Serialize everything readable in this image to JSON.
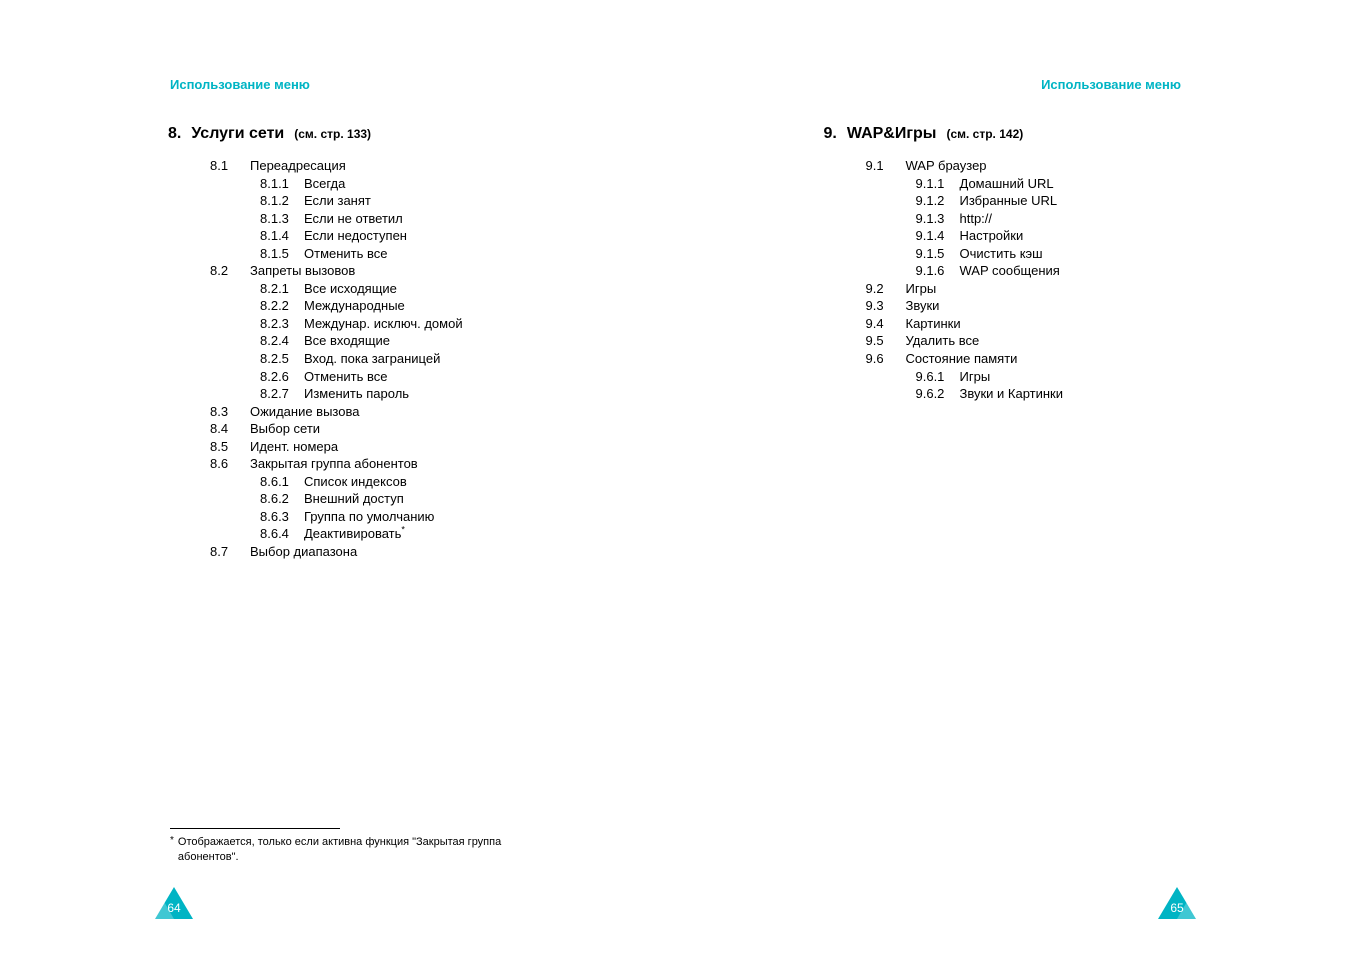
{
  "header": {
    "text": "Использование меню"
  },
  "pageNumbers": {
    "left": "64",
    "right": "65"
  },
  "left": {
    "section": {
      "num": "8.",
      "title": "Услуги сети",
      "ref": "(см. стр. 133)"
    },
    "items": [
      {
        "lvl": 2,
        "num": "8.1",
        "text": "Переадресация"
      },
      {
        "lvl": 3,
        "num": "8.1.1",
        "text": "Всегда"
      },
      {
        "lvl": 3,
        "num": "8.1.2",
        "text": "Если занят"
      },
      {
        "lvl": 3,
        "num": "8.1.3",
        "text": "Если не ответил"
      },
      {
        "lvl": 3,
        "num": "8.1.4",
        "text": "Если недоступен"
      },
      {
        "lvl": 3,
        "num": "8.1.5",
        "text": "Отменить все"
      },
      {
        "lvl": 2,
        "num": "8.2",
        "text": "Запреты вызовов"
      },
      {
        "lvl": 3,
        "num": "8.2.1",
        "text": "Все исходящие"
      },
      {
        "lvl": 3,
        "num": "8.2.2",
        "text": "Международные"
      },
      {
        "lvl": 3,
        "num": "8.2.3",
        "text": "Междунар. исключ. домой"
      },
      {
        "lvl": 3,
        "num": "8.2.4",
        "text": "Все входящие"
      },
      {
        "lvl": 3,
        "num": "8.2.5",
        "text": "Вход. пока заграницей"
      },
      {
        "lvl": 3,
        "num": "8.2.6",
        "text": "Отменить все"
      },
      {
        "lvl": 3,
        "num": "8.2.7",
        "text": "Изменить пароль"
      },
      {
        "lvl": 2,
        "num": "8.3",
        "text": "Ожидание вызова"
      },
      {
        "lvl": 2,
        "num": "8.4",
        "text": "Выбор сети"
      },
      {
        "lvl": 2,
        "num": "8.5",
        "text": "Идент. номера"
      },
      {
        "lvl": 2,
        "num": "8.6",
        "text": "Закрытая группа абонентов"
      },
      {
        "lvl": 3,
        "num": "8.6.1",
        "text": "Список индексов"
      },
      {
        "lvl": 3,
        "num": "8.6.2",
        "text": "Внешний доступ"
      },
      {
        "lvl": 3,
        "num": "8.6.3",
        "text": "Группа по умолчанию"
      },
      {
        "lvl": 3,
        "num": "8.6.4",
        "text": "Деактивировать",
        "star": true
      },
      {
        "lvl": 2,
        "num": "8.7",
        "text": "Выбор диапазона"
      }
    ],
    "footnote": {
      "mark": "*",
      "text": "Отображается, только если активна функция \"Закрытая группа абонентов\"."
    }
  },
  "right": {
    "section": {
      "num": "9.",
      "title": "WAP&Игры",
      "ref": "(см. стр. 142)"
    },
    "items": [
      {
        "lvl": 2,
        "num": "9.1",
        "text": "WAP браузер"
      },
      {
        "lvl": 3,
        "num": "9.1.1",
        "text": "Домашний URL"
      },
      {
        "lvl": 3,
        "num": "9.1.2",
        "text": "Избранные URL"
      },
      {
        "lvl": 3,
        "num": "9.1.3",
        "text": "http://"
      },
      {
        "lvl": 3,
        "num": "9.1.4",
        "text": "Настройки"
      },
      {
        "lvl": 3,
        "num": "9.1.5",
        "text": "Очистить кэш"
      },
      {
        "lvl": 3,
        "num": "9.1.6",
        "text": "WAP сообщения"
      },
      {
        "lvl": 2,
        "num": "9.2",
        "text": "Игры"
      },
      {
        "lvl": 2,
        "num": "9.3",
        "text": "Звуки"
      },
      {
        "lvl": 2,
        "num": "9.4",
        "text": "Картинки"
      },
      {
        "lvl": 2,
        "num": "9.5",
        "text": "Удалить все"
      },
      {
        "lvl": 2,
        "num": "9.6",
        "text": "Состояние памяти"
      },
      {
        "lvl": 3,
        "num": "9.6.1",
        "text": "Игры"
      },
      {
        "lvl": 3,
        "num": "9.6.2",
        "text": "Звуки и Картинки"
      }
    ]
  }
}
